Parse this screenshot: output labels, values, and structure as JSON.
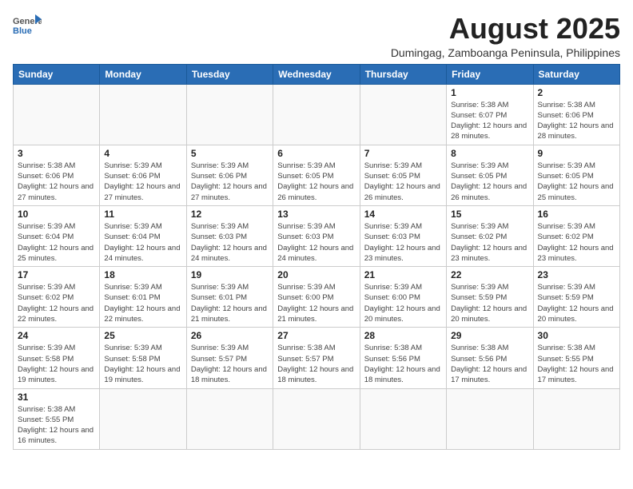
{
  "header": {
    "logo_general": "General",
    "logo_blue": "Blue",
    "title": "August 2025",
    "subtitle": "Dumingag, Zamboanga Peninsula, Philippines"
  },
  "days_of_week": [
    "Sunday",
    "Monday",
    "Tuesday",
    "Wednesday",
    "Thursday",
    "Friday",
    "Saturday"
  ],
  "weeks": [
    [
      {
        "day": "",
        "info": ""
      },
      {
        "day": "",
        "info": ""
      },
      {
        "day": "",
        "info": ""
      },
      {
        "day": "",
        "info": ""
      },
      {
        "day": "",
        "info": ""
      },
      {
        "day": "1",
        "info": "Sunrise: 5:38 AM\nSunset: 6:07 PM\nDaylight: 12 hours and 28 minutes."
      },
      {
        "day": "2",
        "info": "Sunrise: 5:38 AM\nSunset: 6:06 PM\nDaylight: 12 hours and 28 minutes."
      }
    ],
    [
      {
        "day": "3",
        "info": "Sunrise: 5:38 AM\nSunset: 6:06 PM\nDaylight: 12 hours and 27 minutes."
      },
      {
        "day": "4",
        "info": "Sunrise: 5:39 AM\nSunset: 6:06 PM\nDaylight: 12 hours and 27 minutes."
      },
      {
        "day": "5",
        "info": "Sunrise: 5:39 AM\nSunset: 6:06 PM\nDaylight: 12 hours and 27 minutes."
      },
      {
        "day": "6",
        "info": "Sunrise: 5:39 AM\nSunset: 6:05 PM\nDaylight: 12 hours and 26 minutes."
      },
      {
        "day": "7",
        "info": "Sunrise: 5:39 AM\nSunset: 6:05 PM\nDaylight: 12 hours and 26 minutes."
      },
      {
        "day": "8",
        "info": "Sunrise: 5:39 AM\nSunset: 6:05 PM\nDaylight: 12 hours and 26 minutes."
      },
      {
        "day": "9",
        "info": "Sunrise: 5:39 AM\nSunset: 6:05 PM\nDaylight: 12 hours and 25 minutes."
      }
    ],
    [
      {
        "day": "10",
        "info": "Sunrise: 5:39 AM\nSunset: 6:04 PM\nDaylight: 12 hours and 25 minutes."
      },
      {
        "day": "11",
        "info": "Sunrise: 5:39 AM\nSunset: 6:04 PM\nDaylight: 12 hours and 24 minutes."
      },
      {
        "day": "12",
        "info": "Sunrise: 5:39 AM\nSunset: 6:03 PM\nDaylight: 12 hours and 24 minutes."
      },
      {
        "day": "13",
        "info": "Sunrise: 5:39 AM\nSunset: 6:03 PM\nDaylight: 12 hours and 24 minutes."
      },
      {
        "day": "14",
        "info": "Sunrise: 5:39 AM\nSunset: 6:03 PM\nDaylight: 12 hours and 23 minutes."
      },
      {
        "day": "15",
        "info": "Sunrise: 5:39 AM\nSunset: 6:02 PM\nDaylight: 12 hours and 23 minutes."
      },
      {
        "day": "16",
        "info": "Sunrise: 5:39 AM\nSunset: 6:02 PM\nDaylight: 12 hours and 23 minutes."
      }
    ],
    [
      {
        "day": "17",
        "info": "Sunrise: 5:39 AM\nSunset: 6:02 PM\nDaylight: 12 hours and 22 minutes."
      },
      {
        "day": "18",
        "info": "Sunrise: 5:39 AM\nSunset: 6:01 PM\nDaylight: 12 hours and 22 minutes."
      },
      {
        "day": "19",
        "info": "Sunrise: 5:39 AM\nSunset: 6:01 PM\nDaylight: 12 hours and 21 minutes."
      },
      {
        "day": "20",
        "info": "Sunrise: 5:39 AM\nSunset: 6:00 PM\nDaylight: 12 hours and 21 minutes."
      },
      {
        "day": "21",
        "info": "Sunrise: 5:39 AM\nSunset: 6:00 PM\nDaylight: 12 hours and 20 minutes."
      },
      {
        "day": "22",
        "info": "Sunrise: 5:39 AM\nSunset: 5:59 PM\nDaylight: 12 hours and 20 minutes."
      },
      {
        "day": "23",
        "info": "Sunrise: 5:39 AM\nSunset: 5:59 PM\nDaylight: 12 hours and 20 minutes."
      }
    ],
    [
      {
        "day": "24",
        "info": "Sunrise: 5:39 AM\nSunset: 5:58 PM\nDaylight: 12 hours and 19 minutes."
      },
      {
        "day": "25",
        "info": "Sunrise: 5:39 AM\nSunset: 5:58 PM\nDaylight: 12 hours and 19 minutes."
      },
      {
        "day": "26",
        "info": "Sunrise: 5:39 AM\nSunset: 5:57 PM\nDaylight: 12 hours and 18 minutes."
      },
      {
        "day": "27",
        "info": "Sunrise: 5:38 AM\nSunset: 5:57 PM\nDaylight: 12 hours and 18 minutes."
      },
      {
        "day": "28",
        "info": "Sunrise: 5:38 AM\nSunset: 5:56 PM\nDaylight: 12 hours and 18 minutes."
      },
      {
        "day": "29",
        "info": "Sunrise: 5:38 AM\nSunset: 5:56 PM\nDaylight: 12 hours and 17 minutes."
      },
      {
        "day": "30",
        "info": "Sunrise: 5:38 AM\nSunset: 5:55 PM\nDaylight: 12 hours and 17 minutes."
      }
    ],
    [
      {
        "day": "31",
        "info": "Sunrise: 5:38 AM\nSunset: 5:55 PM\nDaylight: 12 hours and 16 minutes."
      },
      {
        "day": "",
        "info": ""
      },
      {
        "day": "",
        "info": ""
      },
      {
        "day": "",
        "info": ""
      },
      {
        "day": "",
        "info": ""
      },
      {
        "day": "",
        "info": ""
      },
      {
        "day": "",
        "info": ""
      }
    ]
  ]
}
